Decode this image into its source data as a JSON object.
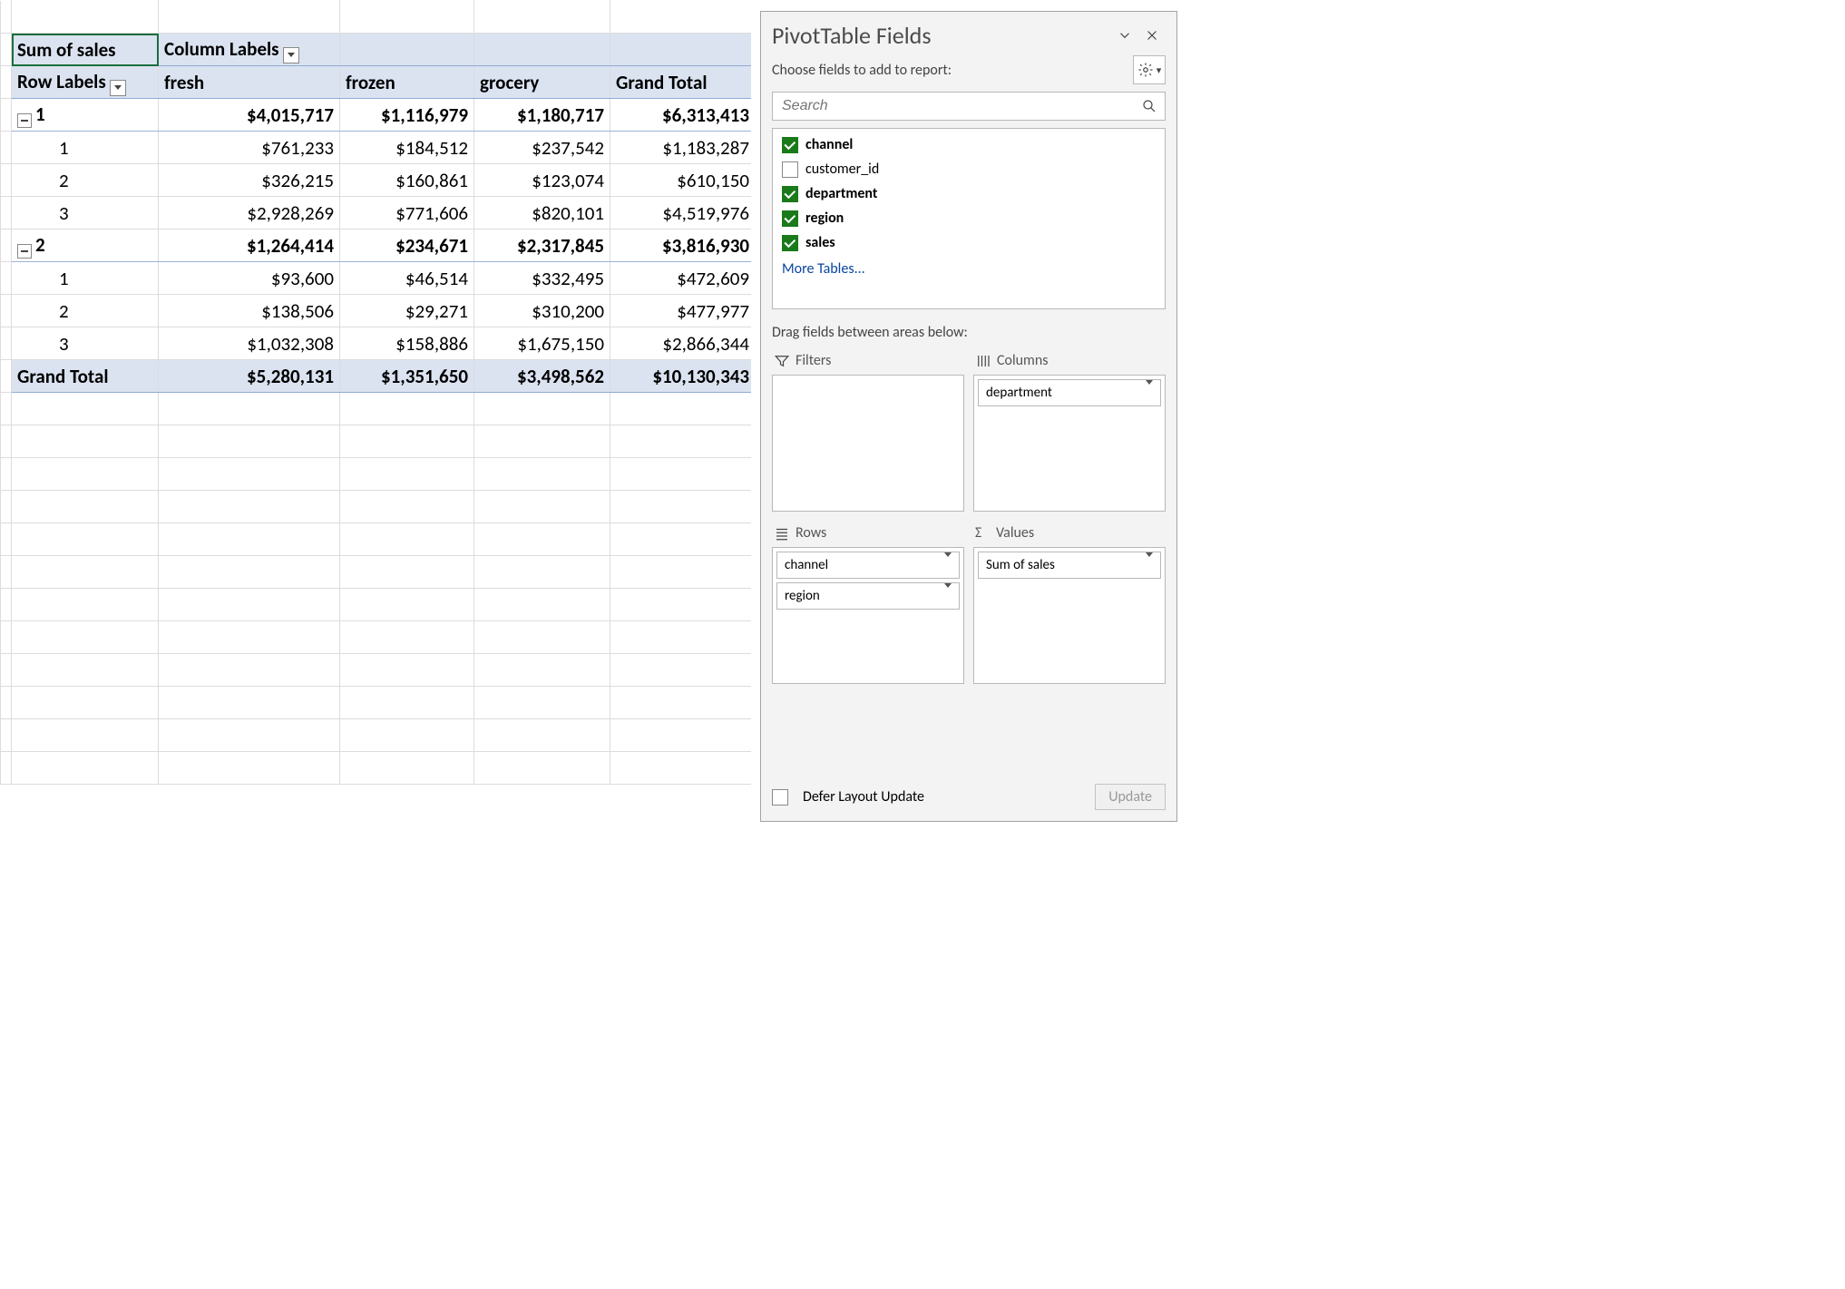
{
  "pivot": {
    "value_label": "Sum of sales",
    "column_header": "Column Labels",
    "row_header": "Row Labels",
    "columns": [
      "fresh",
      "frozen",
      "grocery"
    ],
    "grand_col": "Grand Total",
    "grand_row": "Grand Total",
    "groups": [
      {
        "key": "1",
        "totals": [
          "$4,015,717",
          "$1,116,979",
          "$1,180,717",
          "$6,313,413"
        ],
        "rows": [
          {
            "key": "1",
            "vals": [
              "$761,233",
              "$184,512",
              "$237,542",
              "$1,183,287"
            ]
          },
          {
            "key": "2",
            "vals": [
              "$326,215",
              "$160,861",
              "$123,074",
              "$610,150"
            ]
          },
          {
            "key": "3",
            "vals": [
              "$2,928,269",
              "$771,606",
              "$820,101",
              "$4,519,976"
            ]
          }
        ]
      },
      {
        "key": "2",
        "totals": [
          "$1,264,414",
          "$234,671",
          "$2,317,845",
          "$3,816,930"
        ],
        "rows": [
          {
            "key": "1",
            "vals": [
              "$93,600",
              "$46,514",
              "$332,495",
              "$472,609"
            ]
          },
          {
            "key": "2",
            "vals": [
              "$138,506",
              "$29,271",
              "$310,200",
              "$477,977"
            ]
          },
          {
            "key": "3",
            "vals": [
              "$1,032,308",
              "$158,886",
              "$1,675,150",
              "$2,866,344"
            ]
          }
        ]
      }
    ],
    "grand_totals": [
      "$5,280,131",
      "$1,351,650",
      "$3,498,562",
      "$10,130,343"
    ]
  },
  "pane": {
    "title": "PivotTable Fields",
    "choose_hint": "Choose fields to add to report:",
    "search_placeholder": "Search",
    "fields": [
      {
        "name": "channel",
        "checked": true
      },
      {
        "name": "customer_id",
        "checked": false
      },
      {
        "name": "department",
        "checked": true
      },
      {
        "name": "region",
        "checked": true
      },
      {
        "name": "sales",
        "checked": true
      }
    ],
    "more_tables": "More Tables...",
    "drag_hint": "Drag fields between areas below:",
    "areas": {
      "filters": {
        "label": "Filters",
        "items": []
      },
      "columns": {
        "label": "Columns",
        "items": [
          "department"
        ]
      },
      "rows": {
        "label": "Rows",
        "items": [
          "channel",
          "region"
        ]
      },
      "values": {
        "label": "Values",
        "items": [
          "Sum of sales"
        ]
      }
    },
    "defer_label": "Defer Layout Update",
    "update_label": "Update",
    "values_sigma": "Σ"
  }
}
